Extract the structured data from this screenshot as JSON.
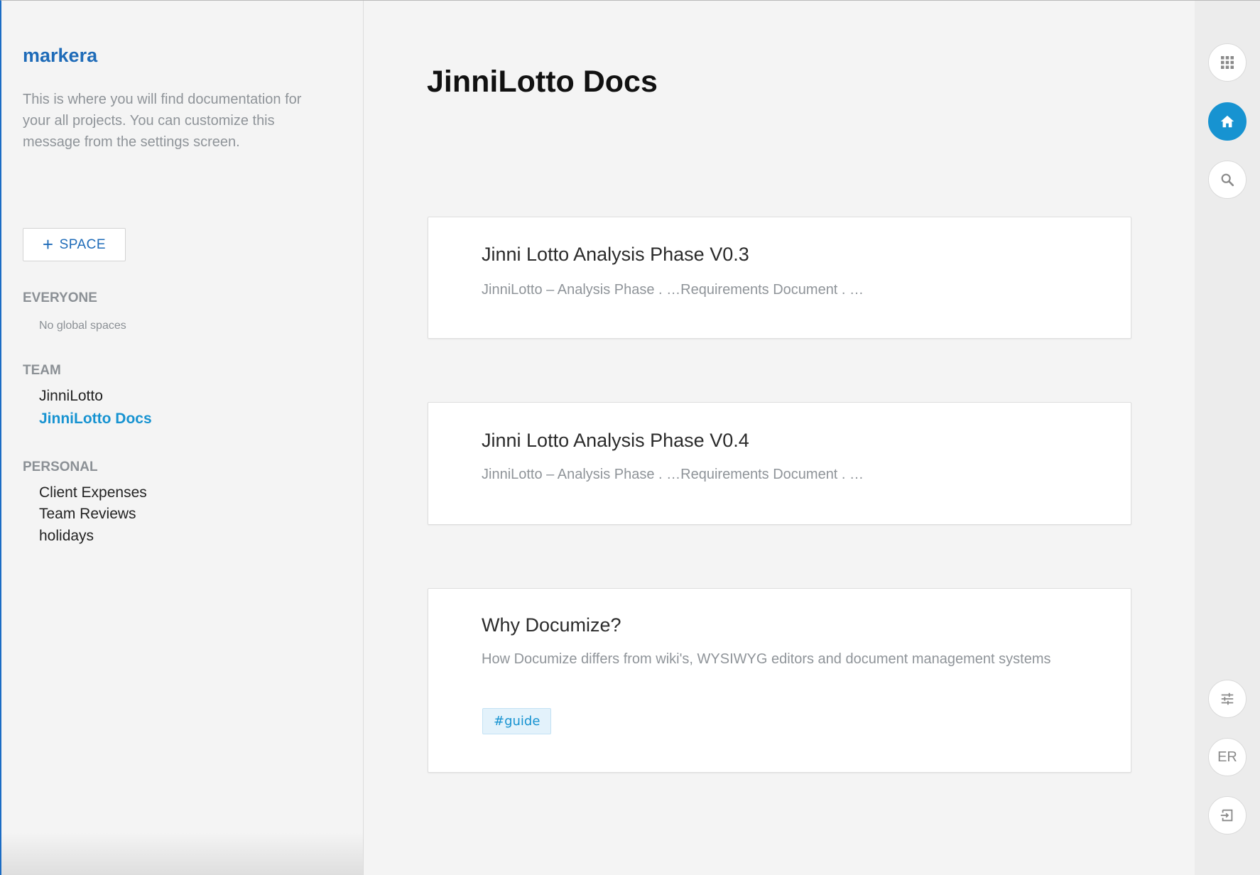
{
  "sidebar": {
    "org_name": "markera",
    "message": "This is where you will find documentation for your all projects. You can customize this message from the settings screen.",
    "add_space_label": "SPACE",
    "sections": {
      "everyone": {
        "title": "EVERYONE",
        "empty": "No global spaces"
      },
      "team": {
        "title": "TEAM",
        "items": [
          "JinniLotto",
          "JinniLotto Docs"
        ],
        "active": "JinniLotto Docs"
      },
      "personal": {
        "title": "PERSONAL",
        "items": [
          "Client Expenses",
          "Team Reviews",
          "holidays"
        ]
      }
    }
  },
  "main": {
    "title": "JinniLotto Docs",
    "documents": [
      {
        "title": "Jinni Lotto Analysis Phase V0.3",
        "excerpt": "JinniLotto – Analysis Phase . …Requirements Document . …"
      },
      {
        "title": "Jinni Lotto Analysis Phase V0.4",
        "excerpt": "JinniLotto – Analysis Phase . …Requirements Document . …"
      },
      {
        "title": "Why Documize?",
        "excerpt": "How Documize differs from wiki's, WYSIWYG editors and document management systems",
        "tags": [
          "#guide"
        ]
      }
    ]
  },
  "rail": {
    "buttons": [
      "apps-grid-icon",
      "home-icon",
      "search-icon",
      "settings-sliders-icon",
      "user-avatar",
      "logout-icon"
    ],
    "active": "home-icon",
    "user_initials": "ER"
  },
  "colors": {
    "accent": "#1793d1",
    "brand": "#1e6bb8",
    "muted_text": "#8f9499"
  }
}
